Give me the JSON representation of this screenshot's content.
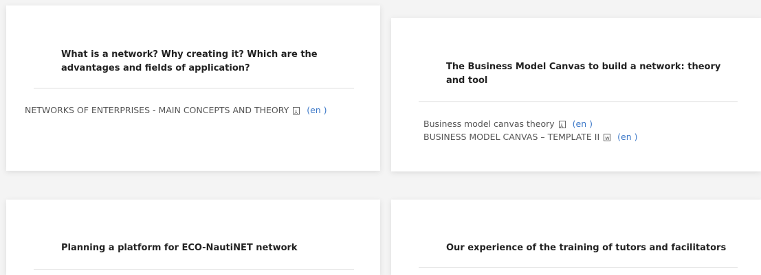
{
  "cards": [
    {
      "title_line1": "What is a network? Why creating it? Which are the",
      "title_line2": "advantages and fields of application?",
      "links": [
        {
          "text": "NETWORKS OF ENTERPRISES - MAIN CONCEPTS AND THEORY",
          "icon": "pdf-icon",
          "lang": "(en )"
        }
      ]
    },
    {
      "title_line1": "The Business Model Canvas to build a network: theory",
      "title_line2": "and tool",
      "links": [
        {
          "text": "Business model canvas theory",
          "icon": "pdf-icon",
          "lang": "(en )"
        },
        {
          "text": "BUSINESS MODEL CANVAS – TEMPLATE II",
          "icon": "word-icon",
          "lang": "(en )"
        }
      ]
    },
    {
      "title_line1": "Planning a platform for ECO-NautiNET network",
      "title_line2": ""
    },
    {
      "title_line1": "Our experience of the training of tutors and facilitators",
      "title_line2": ""
    }
  ]
}
